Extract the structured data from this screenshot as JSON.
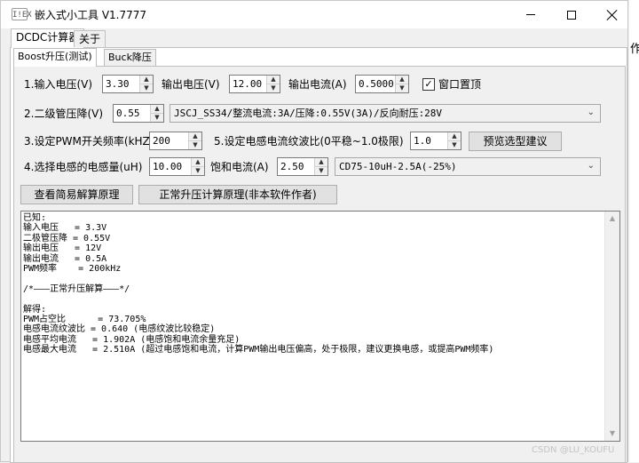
{
  "window": {
    "icon_text": "I!EX",
    "title": "嵌入式小工具 V1.7777",
    "side_glyph": "作"
  },
  "outer_tabs": [
    {
      "label": "DCDC计算器"
    },
    {
      "label": "关于"
    }
  ],
  "inner_tabs": [
    {
      "label": "Boost升压(测试)"
    },
    {
      "label": "Buck降压"
    }
  ],
  "row1": {
    "vin_label": "1.输入电压(V)",
    "vin_value": "3.30",
    "vout_label": "输出电压(V)",
    "vout_value": "12.00",
    "iout_label": "输出电流(A)",
    "iout_value": "0.5000",
    "topmost_label": "窗口置顶",
    "topmost_checked": true
  },
  "row2": {
    "diode_label": "2.二级管压降(V)",
    "diode_value": "0.55",
    "diode_select": "JSCJ_SS34/整流电流:3A/压降:0.55V(3A)/反向耐压:28V"
  },
  "row3": {
    "freq_label": "3.设定PWM开关频率(kHZ)",
    "freq_value": "200",
    "ripple_label": "5.设定电感电流纹波比(0平稳~1.0极限)",
    "ripple_value": "1.0",
    "preview_button": "预览选型建议"
  },
  "row4": {
    "l_label": "4.选择电感的电感量(uH)",
    "l_value": "10.00",
    "isat_label": "饱和电流(A)",
    "isat_value": "2.50",
    "inductor_select": "CD75-10uH-2.5A(-25%)"
  },
  "buttons": {
    "simple_principle": "查看简易解算原理",
    "normal_principle": "正常升压计算原理(非本软件作者)"
  },
  "output": {
    "text": "已知:\n输入电压   = 3.3V\n二极管压降 = 0.55V\n输出电压   = 12V\n输出电流   = 0.5A\nPWM频率    = 200kHz\n\n/*———正常升压解算———*/\n\n解得:\nPWM占空比      = 73.705%\n电感电流纹波比 = 0.640 (电感纹波比较稳定)\n电感平均电流   = 1.902A (电感饱和电流余量充足)\n电感最大电流   = 2.510A (超过电感饱和电流，计算PWM输出电压偏高，处于极限，建议更换电感，或提高PWM频率)"
  },
  "watermark": "CSDN @LU_KOUFU",
  "icons": {
    "minimize": "minimize-icon",
    "maximize": "maximize-icon",
    "close": "close-icon",
    "spin_up": "▲",
    "spin_down": "▼",
    "dropdown": "⌄",
    "check": "✓",
    "scroll_up": "▲",
    "scroll_down": "▼"
  }
}
